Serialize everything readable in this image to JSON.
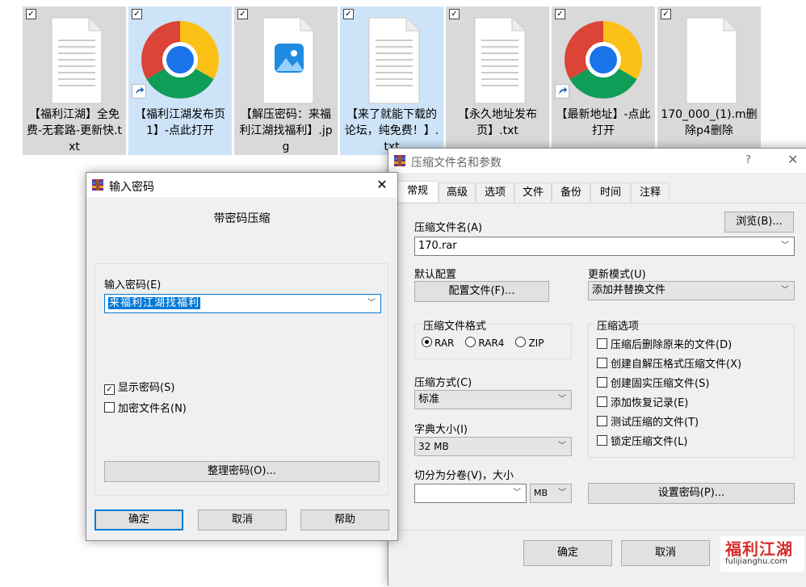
{
  "files": [
    {
      "name": "【福利江湖】全免费-无套路-更新快.txt",
      "type": "txt",
      "selected": true,
      "checked": true
    },
    {
      "name": "【福利江湖发布页1】-点此打开",
      "type": "chrome",
      "selected": false,
      "checked": true
    },
    {
      "name": "【解压密码：来福利江湖找福利】.jpg",
      "type": "jpg",
      "selected": true,
      "checked": true
    },
    {
      "name": "【来了就能下载的论坛，纯免费！】.txt",
      "type": "txt",
      "selected": false,
      "checked": true
    },
    {
      "name": "【永久地址发布页】.txt",
      "type": "txt",
      "selected": true,
      "checked": true
    },
    {
      "name": "【最新地址】-点此打开",
      "type": "chrome",
      "selected": true,
      "checked": true
    },
    {
      "name": "170_000_(1).m删除p4删除",
      "type": "blank",
      "selected": true,
      "checked": true
    }
  ],
  "password_dialog": {
    "title": "输入密码",
    "heading": "带密码压缩",
    "password_label": "输入密码(E)",
    "password_value": "来福利江湖找福利",
    "show_password": "显示密码(S)",
    "encrypt_names": "加密文件名(N)",
    "organize_button": "整理密码(O)...",
    "ok": "确定",
    "cancel": "取消",
    "help": "帮助"
  },
  "archive_dialog": {
    "title": "压缩文件名和参数",
    "help_glyph": "?",
    "tabs": [
      "常规",
      "高级",
      "选项",
      "文件",
      "备份",
      "时间",
      "注释"
    ],
    "archive_name_label": "压缩文件名(A)",
    "browse_button": "浏览(B)...",
    "archive_name_value": "170.rar",
    "default_profile_label": "默认配置",
    "profile_button": "配置文件(F)...",
    "update_mode_label": "更新模式(U)",
    "update_mode_value": "添加并替换文件",
    "format_group": "压缩文件格式",
    "formats": [
      "RAR",
      "RAR4",
      "ZIP"
    ],
    "options_group": "压缩选项",
    "options": [
      "压缩后删除原来的文件(D)",
      "创建自解压格式压缩文件(X)",
      "创建固实压缩文件(S)",
      "添加恢复记录(E)",
      "测试压缩的文件(T)",
      "锁定压缩文件(L)"
    ],
    "method_label": "压缩方式(C)",
    "method_value": "标准",
    "dict_label": "字典大小(I)",
    "dict_value": "32 MB",
    "split_label": "切分为分卷(V)，大小",
    "split_unit": "MB",
    "set_password_button": "设置密码(P)...",
    "ok": "确定",
    "cancel": "取消"
  },
  "watermark": {
    "line1": "福利江湖",
    "line2": "fulijianghu.com"
  }
}
